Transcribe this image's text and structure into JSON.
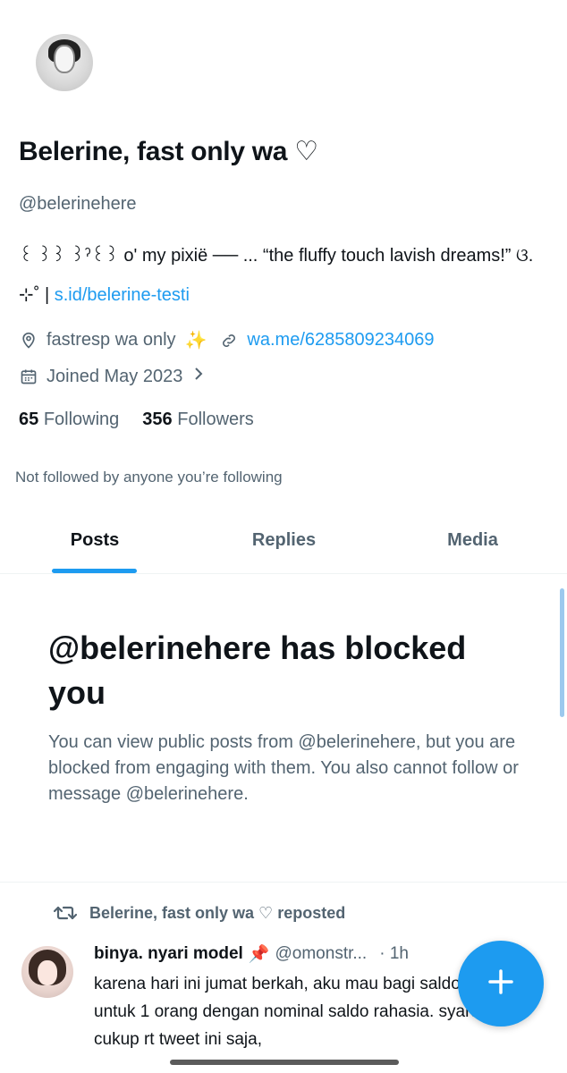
{
  "profile": {
    "display_name": "Belerine, fast only wa ♡",
    "handle": "@belerinehere",
    "bio_text": "꒰ ꒱꒱ ꒱ˀ꒰꒱ o' my pixië ── ... “the fluffy touch lavish dreams!” ଓ. ⊹˚ | ",
    "bio_link": "s.id/belerine-testi",
    "location": "fastresp wa only",
    "location_emoji": "✨",
    "website": "wa.me/6285809234069",
    "joined": "Joined May 2023",
    "following_count": "65",
    "following_label": "Following",
    "followers_count": "356",
    "followers_label": "Followers",
    "not_followed_text": "Not followed by anyone you’re following"
  },
  "tabs": [
    {
      "label": "Posts",
      "active": true
    },
    {
      "label": "Replies",
      "active": false
    },
    {
      "label": "Media",
      "active": false
    }
  ],
  "blocked": {
    "title": "@belerinehere has blocked you",
    "text": "You can view public posts from @belerinehere, but you are blocked from engaging with them. You also cannot follow or message @belerinehere."
  },
  "post": {
    "repost_label": "Belerine, fast only wa ♡ reposted",
    "author_name": "binya. nyari model",
    "author_emoji": "📌",
    "author_handle": "@omonstr...",
    "time": "· 1h",
    "body": "karena hari ini jumat berkah, aku mau bagi saldo ovo/qris untuk 1 orang dengan nominal saldo rahasia. syaratnya cukup rt tweet ini saja,"
  },
  "icons": {
    "location": "location-pin-icon",
    "link": "link-icon",
    "calendar": "calendar-icon",
    "chevron": "chevron-right-icon",
    "repost": "repost-icon",
    "compose": "plus-icon"
  },
  "colors": {
    "accent": "#1d9bf0",
    "text_primary": "#0f1419",
    "text_secondary": "#536471"
  }
}
